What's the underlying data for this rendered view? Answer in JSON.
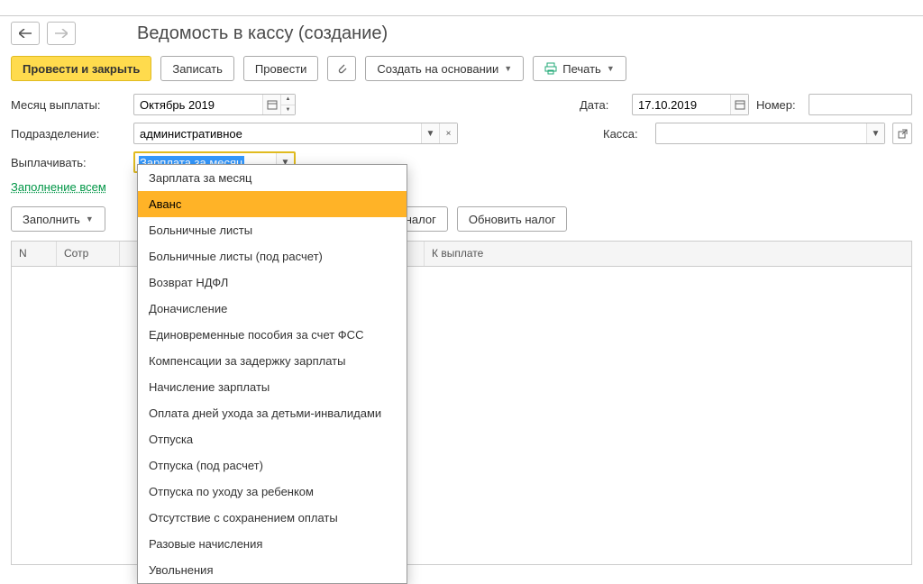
{
  "header": {
    "title": "Ведомость в кассу (создание)"
  },
  "toolbar": {
    "post_close": "Провести и закрыть",
    "write": "Записать",
    "post": "Провести",
    "create_based": "Создать на основании",
    "print": "Печать"
  },
  "form": {
    "month_label": "Месяц выплаты:",
    "month_value": "Октябрь 2019",
    "date_label": "Дата:",
    "date_value": "17.10.2019",
    "number_label": "Номер:",
    "number_value": "",
    "dept_label": "Подразделение:",
    "dept_value": "административное",
    "cash_label": "Касса:",
    "cash_value": "",
    "pay_label": "Выплачивать:",
    "pay_value": "Зарплата за месяц",
    "fill_all_link": "Заполнение всем"
  },
  "table_toolbar": {
    "fill": "Заполнить",
    "tax_suffix": "налог",
    "update_tax": "Обновить налог"
  },
  "grid": {
    "columns": [
      "N",
      "Сотр",
      "",
      "К выплате"
    ]
  },
  "dropdown": {
    "items": [
      "Зарплата за месяц",
      "Аванс",
      "Больничные листы",
      "Больничные листы (под расчет)",
      "Возврат НДФЛ",
      "Доначисление",
      "Единовременные пособия за счет ФСС",
      "Компенсации за задержку зарплаты",
      "Начисление зарплаты",
      "Оплата дней ухода за детьми-инвалидами",
      "Отпуска",
      "Отпуска (под расчет)",
      "Отпуска по уходу за ребенком",
      "Отсутствие с сохранением оплаты",
      "Разовые начисления",
      "Увольнения"
    ],
    "hover_index": 1
  }
}
